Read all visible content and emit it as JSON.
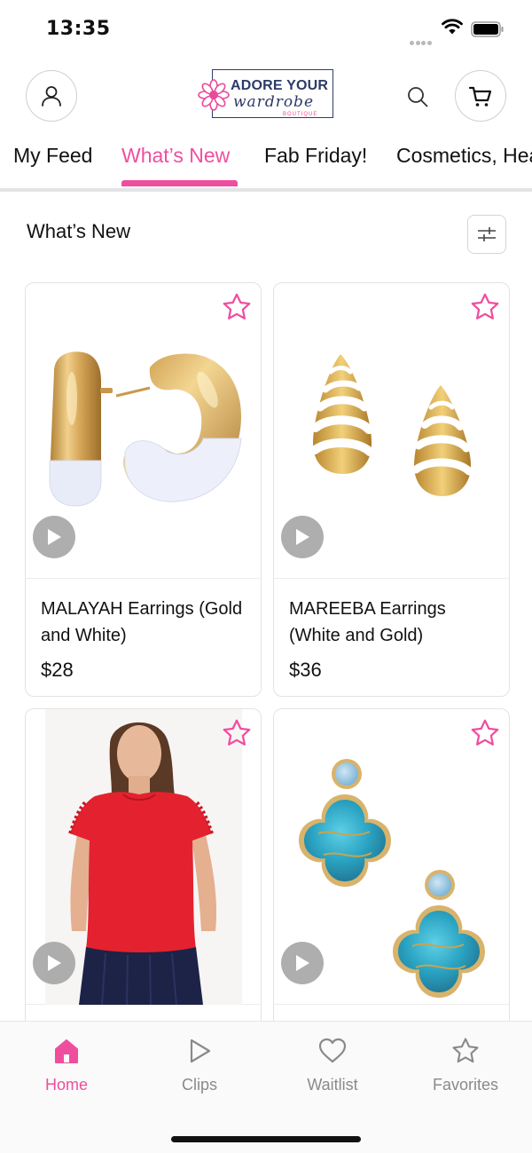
{
  "status_bar": {
    "time": "13:35"
  },
  "header": {
    "logo": {
      "line1": "ADORE YOUR",
      "line2": "wardrobe",
      "line3": "BOUTIQUE"
    }
  },
  "tabs": [
    {
      "label": "My Feed",
      "active": false
    },
    {
      "label": "What’s New",
      "active": true
    },
    {
      "label": "Fab Friday!",
      "active": false
    },
    {
      "label": "Cosmetics, Hea",
      "active": false
    }
  ],
  "section": {
    "title": "What’s New"
  },
  "products": [
    {
      "name": "MALAYAH Earrings (Gold and White)",
      "price": "$28"
    },
    {
      "name": "MAREEBA Earrings (White and Gold)",
      "price": "$36"
    },
    {
      "name": "",
      "price": ""
    },
    {
      "name": "",
      "price": ""
    }
  ],
  "bottom_nav": [
    {
      "label": "Home",
      "icon": "home-icon",
      "active": true
    },
    {
      "label": "Clips",
      "icon": "play-outline-icon",
      "active": false
    },
    {
      "label": "Waitlist",
      "icon": "heart-icon",
      "active": false
    },
    {
      "label": "Favorites",
      "icon": "star-icon",
      "active": false
    }
  ],
  "colors": {
    "accent": "#ef4e9f",
    "brand_navy": "#2c3a68",
    "nav_inactive": "#8a8a8a"
  }
}
